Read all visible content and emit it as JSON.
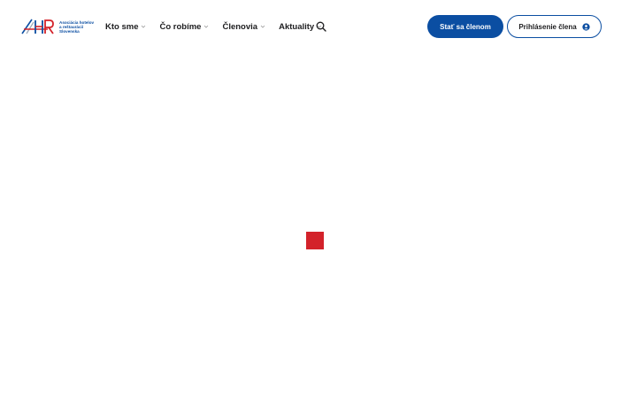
{
  "logo": {
    "mark": "AHR",
    "line1": "Asociácia hotelov",
    "line2": "a reštaurácií",
    "line3": "Slovenska"
  },
  "nav": {
    "items": [
      {
        "label": "Kto sme"
      },
      {
        "label": "Čo robíme"
      },
      {
        "label": "Členovia"
      },
      {
        "label": "Aktuality"
      }
    ]
  },
  "actions": {
    "become_member": "Stať sa členom",
    "member_login": "Prihlásenie člena"
  },
  "colors": {
    "brand_blue": "#0b4ea2",
    "brand_red": "#d3222a"
  },
  "icons": {
    "search": "search-icon",
    "user": "user-icon",
    "chevron": "chevron-down-icon"
  }
}
